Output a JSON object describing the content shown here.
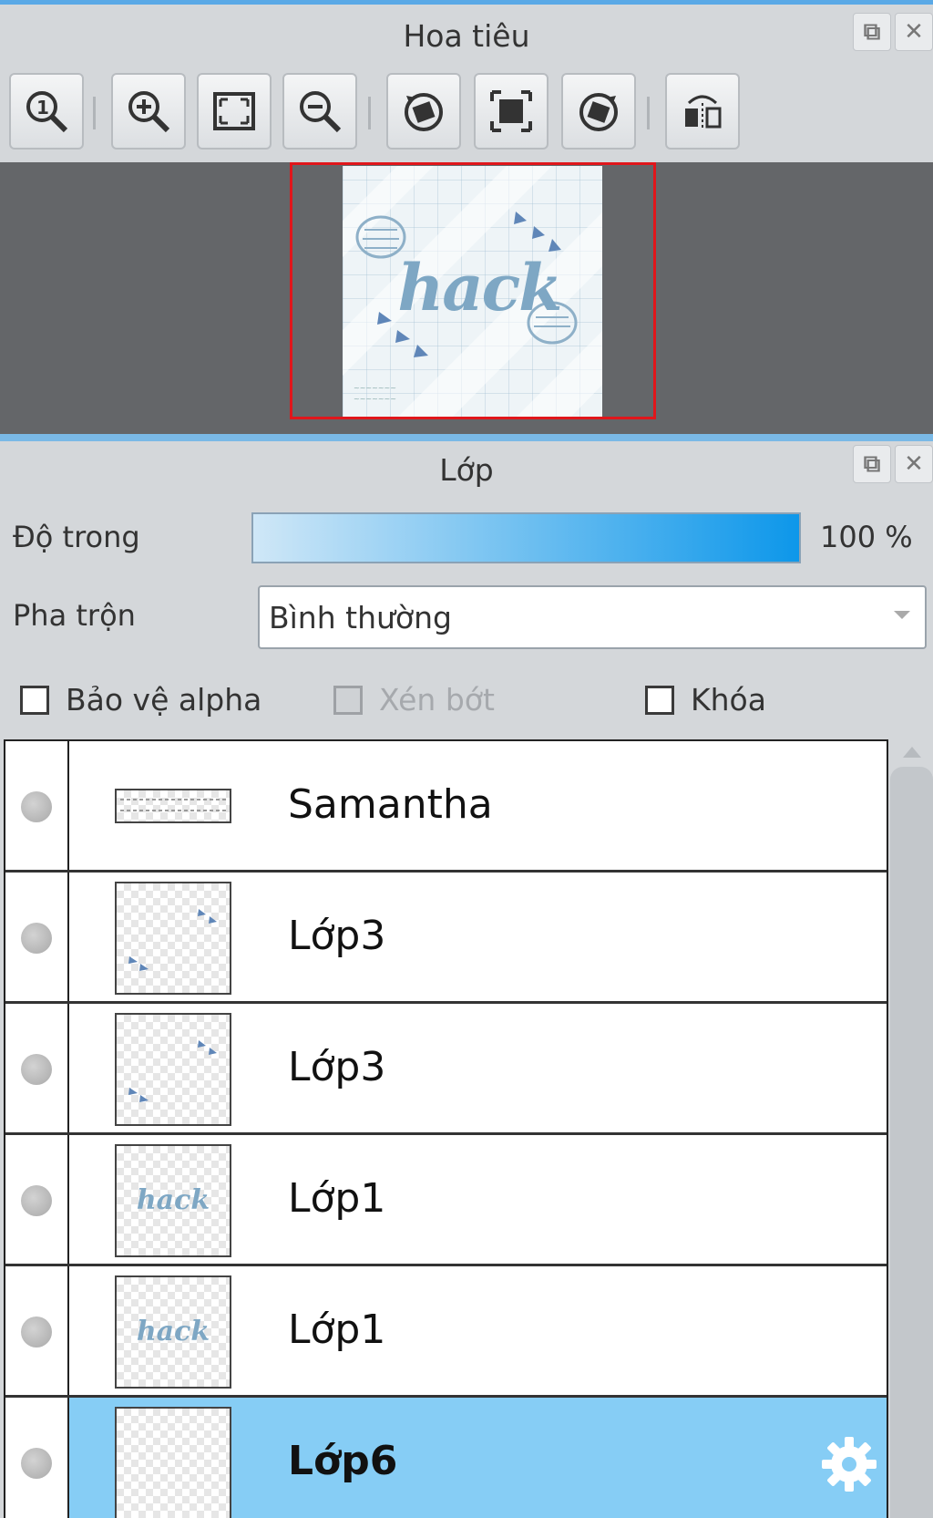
{
  "navigator": {
    "title": "Hoa tiêu",
    "toolbar": [
      {
        "icon": "zoom-actual-size-icon"
      },
      {
        "icon": "zoom-in-icon"
      },
      {
        "icon": "fit-to-window-icon"
      },
      {
        "icon": "zoom-out-icon"
      },
      {
        "icon": "rotate-left-icon"
      },
      {
        "icon": "reset-view-icon"
      },
      {
        "icon": "rotate-right-icon"
      },
      {
        "icon": "flip-horizontal-icon"
      }
    ],
    "preview_text": "hack",
    "frame_color": "#e0161b"
  },
  "layers_panel": {
    "title": "Lớp",
    "opacity_label": "Độ trong",
    "opacity_value": "100 %",
    "opacity_fraction": 1.0,
    "blend_label": "Pha trộn",
    "blend_value": "Bình thường",
    "checkboxes": {
      "protect_alpha": "Bảo vệ alpha",
      "clipping": "Xén bớt",
      "lock": "Khóa"
    },
    "layers": [
      {
        "name": "Samantha",
        "thumb": "banner",
        "selected": false
      },
      {
        "name": "Lớp3",
        "thumb": "leaves",
        "selected": false
      },
      {
        "name": "Lớp3",
        "thumb": "leaves",
        "selected": false
      },
      {
        "name": "Lớp1",
        "thumb": "hack",
        "thumb_text": "hack",
        "selected": false
      },
      {
        "name": "Lớp1",
        "thumb": "hack",
        "thumb_text": "hack",
        "selected": false
      },
      {
        "name": "Lớp6",
        "thumb": "empty",
        "selected": true
      }
    ],
    "selected_color": "#86cdf5",
    "accent_color": "#5aa9e6"
  }
}
